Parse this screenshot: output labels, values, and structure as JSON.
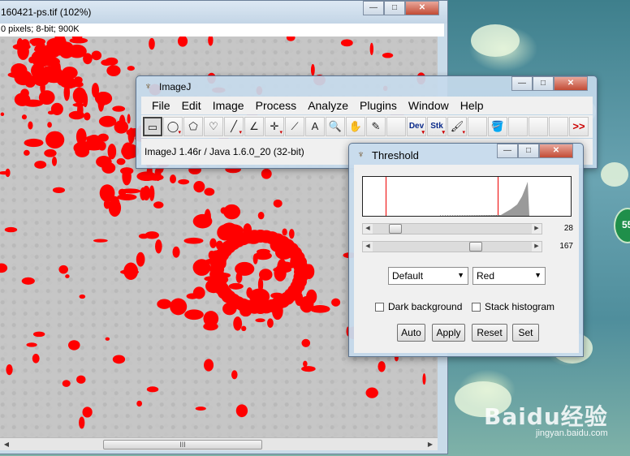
{
  "image_window": {
    "title": "160421-ps.tif (102%)",
    "info": "0 pixels; 8-bit; 900K",
    "scroll_thumb_label": "III"
  },
  "imagej_window": {
    "title": "ImageJ",
    "menus": [
      "File",
      "Edit",
      "Image",
      "Process",
      "Analyze",
      "Plugins",
      "Window",
      "Help"
    ],
    "tools": [
      {
        "icon": "rectangle-select-icon",
        "glyph": "▭",
        "selected": true
      },
      {
        "icon": "oval-select-icon",
        "glyph": "◯"
      },
      {
        "icon": "polygon-select-icon",
        "glyph": "⬠"
      },
      {
        "icon": "freehand-select-icon",
        "glyph": "♡"
      },
      {
        "icon": "line-tool-icon",
        "glyph": "╱"
      },
      {
        "icon": "angle-tool-icon",
        "glyph": "∠"
      },
      {
        "icon": "point-tool-icon",
        "glyph": "✛"
      },
      {
        "icon": "wand-tool-icon",
        "glyph": "⟋"
      },
      {
        "icon": "text-tool-icon",
        "glyph": "A"
      },
      {
        "icon": "magnifier-icon",
        "glyph": "🔍"
      },
      {
        "icon": "hand-tool-icon",
        "glyph": "✋"
      },
      {
        "icon": "color-picker-icon",
        "glyph": "✎"
      },
      {
        "icon": "blank-slot",
        "glyph": ""
      },
      {
        "icon": "dev-menu-icon",
        "glyph": "Dev",
        "text": true
      },
      {
        "icon": "stk-menu-icon",
        "glyph": "Stk",
        "text": true
      },
      {
        "icon": "brush-tool-icon",
        "glyph": "🖌"
      },
      {
        "icon": "blank-slot",
        "glyph": ""
      },
      {
        "icon": "flood-fill-icon",
        "glyph": "🪣"
      },
      {
        "icon": "blank-slot",
        "glyph": ""
      },
      {
        "icon": "blank-slot",
        "glyph": ""
      },
      {
        "icon": "blank-slot",
        "glyph": ""
      },
      {
        "icon": "more-tools-icon",
        "glyph": ">>"
      }
    ],
    "status": "ImageJ 1.46r / Java 1.6.0_20 (32-bit)"
  },
  "threshold_window": {
    "title": "Threshold",
    "min_value": "28",
    "max_value": "167",
    "min_fraction": 0.11,
    "max_fraction": 0.655,
    "method": "Default",
    "display": "Red",
    "dark_background": {
      "label": "Dark background",
      "checked": false
    },
    "stack_histogram": {
      "label": "Stack histogram",
      "checked": false
    },
    "buttons": {
      "auto": "Auto",
      "apply": "Apply",
      "reset": "Reset",
      "set": "Set"
    }
  },
  "desktop": {
    "badge_text": "55",
    "watermark_logo": "Baidu经验",
    "watermark_url": "jingyan.baidu.com"
  },
  "colors": {
    "threshold_overlay": "#ff0000",
    "window_frame": "#c6daec"
  }
}
